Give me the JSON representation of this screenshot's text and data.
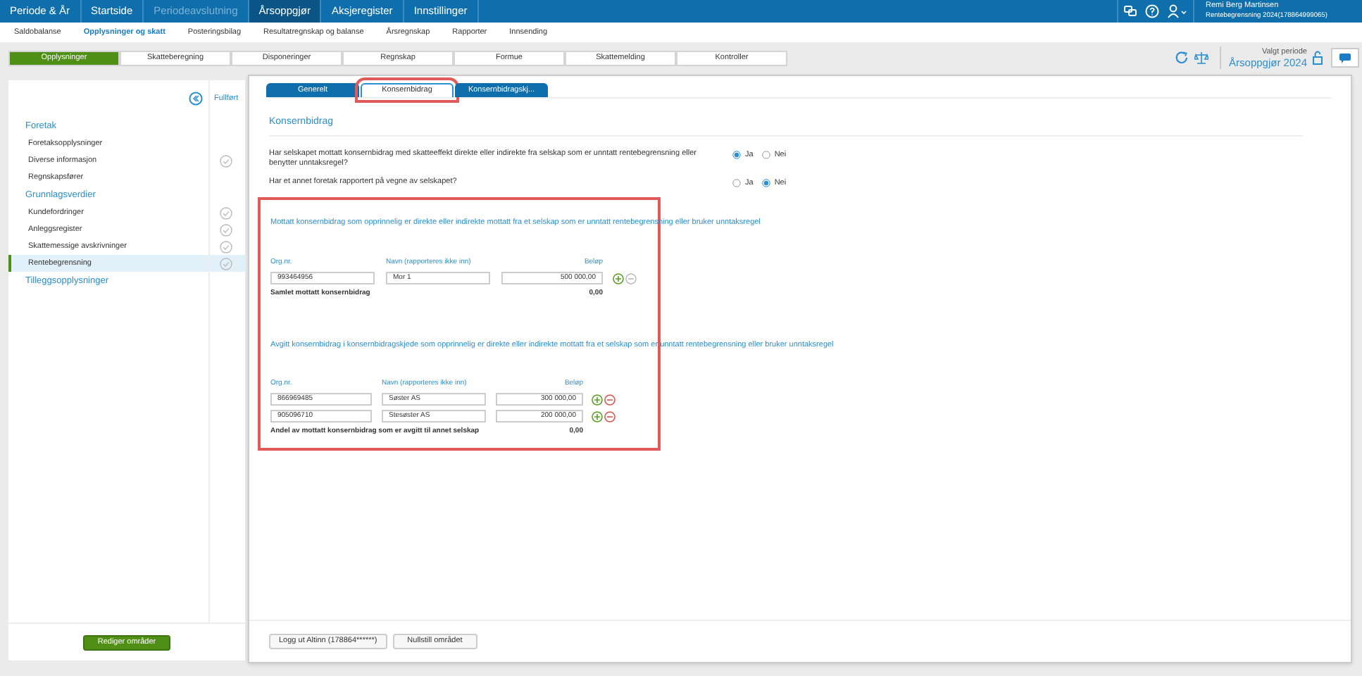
{
  "top_nav": [
    {
      "label": "Periode & År",
      "selected": false,
      "disabled": false
    },
    {
      "label": "Startside",
      "selected": false,
      "disabled": false
    },
    {
      "label": "Periodeavslutning",
      "selected": false,
      "disabled": true
    },
    {
      "label": "Årsoppgjør",
      "selected": true,
      "disabled": false
    },
    {
      "label": "Aksjeregister",
      "selected": false,
      "disabled": false
    },
    {
      "label": "Innstillinger",
      "selected": false,
      "disabled": false
    }
  ],
  "user": {
    "name": "Remi Berg Martinsen",
    "context": "Rentebegrensning 2024(178864999065)"
  },
  "sub_nav": [
    {
      "label": "Saldobalanse",
      "selected": false
    },
    {
      "label": "Opplysninger og skatt",
      "selected": true
    },
    {
      "label": "Posteringsbilag",
      "selected": false
    },
    {
      "label": "Resultatregnskap og balanse",
      "selected": false
    },
    {
      "label": "Årsregnskap",
      "selected": false
    },
    {
      "label": "Rapporter",
      "selected": false
    },
    {
      "label": "Innsending",
      "selected": false
    }
  ],
  "step_tabs": [
    {
      "label": "Opplysninger",
      "selected": true
    },
    {
      "label": "Skatteberegning",
      "selected": false
    },
    {
      "label": "Disponeringer",
      "selected": false
    },
    {
      "label": "Regnskap",
      "selected": false
    },
    {
      "label": "Formue",
      "selected": false
    },
    {
      "label": "Skattemelding",
      "selected": false
    },
    {
      "label": "Kontroller",
      "selected": false
    }
  ],
  "period": {
    "label": "Valgt periode",
    "value": "Årsoppgjør 2024"
  },
  "sidebar": {
    "status_header": "Fullført",
    "groups": [
      {
        "title": "Foretak",
        "items": [
          {
            "label": "Foretaksopplysninger",
            "done": false,
            "selected": false
          },
          {
            "label": "Diverse informasjon",
            "done": true,
            "selected": false
          },
          {
            "label": "Regnskapsfører",
            "done": false,
            "selected": false
          }
        ]
      },
      {
        "title": "Grunnlagsverdier",
        "items": [
          {
            "label": "Kundefordringer",
            "done": true,
            "selected": false
          },
          {
            "label": "Anleggsregister",
            "done": true,
            "selected": false
          },
          {
            "label": "Skattemessige avskrivninger",
            "done": true,
            "selected": false
          },
          {
            "label": "Rentebegrensning",
            "done": true,
            "selected": true
          }
        ]
      },
      {
        "title": "Tilleggsopplysninger"
      }
    ],
    "edit_button": "Rediger områder"
  },
  "content_tabs": [
    {
      "label": "Generelt",
      "selected": false
    },
    {
      "label": "Konsernbidrag",
      "selected": true
    },
    {
      "label": "Konsernbidragskj...",
      "selected": false
    }
  ],
  "heading": "Konsernbidrag",
  "questions": [
    {
      "text": "Har selskapet mottatt konsernbidrag med skatteeffekt direkte eller indirekte fra selskap som er unntatt rentebegrensning eller benytter unntaksregel?",
      "options": [
        {
          "label": "Ja",
          "selected": true
        },
        {
          "label": "Nei",
          "selected": false
        }
      ]
    },
    {
      "text": "Har et annet foretak rapportert på vegne av selskapet?",
      "options": [
        {
          "label": "Ja",
          "selected": false
        },
        {
          "label": "Nei",
          "selected": true
        }
      ]
    }
  ],
  "sections": [
    {
      "title": "Mottatt konsernbidrag som opprinnelig er direkte eller indirekte mottatt fra et selskap som er unntatt rentebegrensning eller bruker unntaksregel",
      "columns": [
        "Org.nr.",
        "Navn (rapporteres ikke inn)",
        "Beløp"
      ],
      "rows": [
        {
          "org": "993464956",
          "name": "Mor 1",
          "amount": "500 000,00",
          "removable": false
        }
      ],
      "total_label": "Samlet mottatt konsernbidrag",
      "total": "0,00"
    },
    {
      "title": "Avgitt konsernbidrag i konsernbidragskjede som opprinnelig er direkte eller indirekte mottatt fra et selskap som er unntatt rentebegrensning eller bruker unntaksregel",
      "columns": [
        "Org.nr.",
        "Navn (rapporteres ikke inn)",
        "Beløp"
      ],
      "rows": [
        {
          "org": "866969485",
          "name": "Søster AS",
          "amount": "300 000,00",
          "removable": true
        },
        {
          "org": "905096710",
          "name": "Stesøster AS",
          "amount": "200 000,00",
          "removable": true
        }
      ],
      "total_label": "Andel av mottatt konsernbidrag som er avgitt til annet selskap",
      "total": "0,00"
    }
  ],
  "footer_buttons": [
    "Logg ut Altinn (178864******)",
    "Nullstill området"
  ]
}
